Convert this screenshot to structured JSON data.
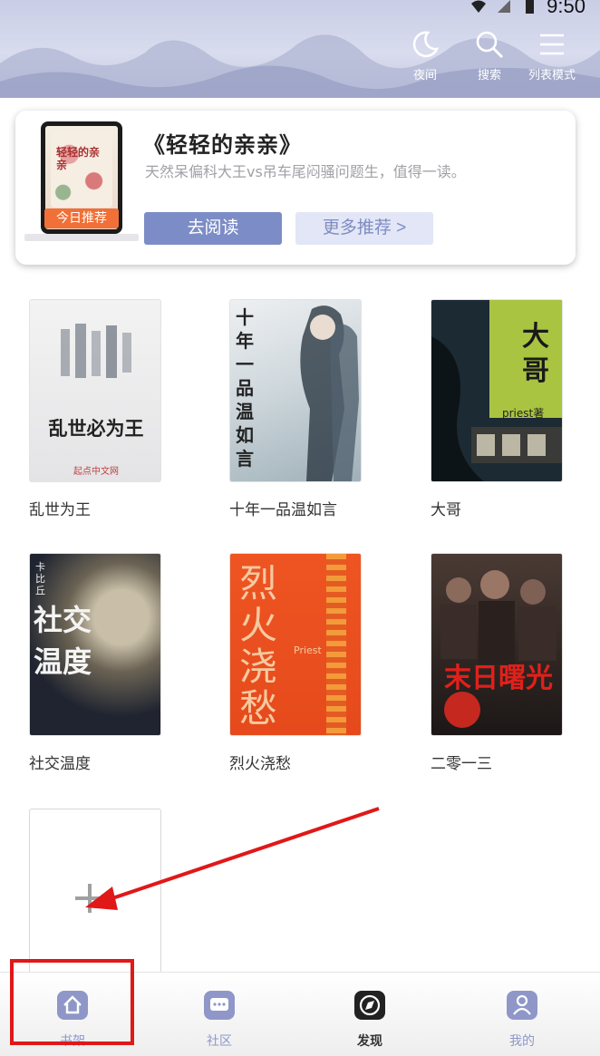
{
  "status_bar": {
    "time": "9:50"
  },
  "top_actions": [
    {
      "label": "夜间",
      "icon": "moon-icon"
    },
    {
      "label": "搜索",
      "icon": "search-icon"
    },
    {
      "label": "列表模式",
      "icon": "list-icon"
    }
  ],
  "recommend": {
    "badge": "今日推荐",
    "cover_text": "轻轻的亲亲",
    "title": "《轻轻的亲亲》",
    "description": "天然呆偏科大王vs吊车尾闷骚问题生，值得一读。",
    "read_button": "去阅读",
    "more_button": "更多推荐 >"
  },
  "books": [
    {
      "title": "乱世为王",
      "cover_text": "乱世必为王",
      "cover_sub": "起点中文网"
    },
    {
      "title": "十年一品温如言",
      "cover_text": "十年一品温如言"
    },
    {
      "title": "大哥",
      "cover_text": "大哥",
      "cover_sub": "priest著"
    },
    {
      "title": "社交温度",
      "cover_text": "社交温度",
      "cover_sub": "卡比丘"
    },
    {
      "title": "烈火浇愁",
      "cover_text": "烈火浇愁",
      "cover_sub": "Priest"
    },
    {
      "title": "二零一三",
      "cover_text": "末日曙光"
    }
  ],
  "bottom_nav": [
    {
      "label": "书架",
      "icon": "home-icon",
      "active": false
    },
    {
      "label": "社区",
      "icon": "chat-icon",
      "active": false
    },
    {
      "label": "发现",
      "icon": "compass-icon",
      "active": true
    },
    {
      "label": "我的",
      "icon": "user-icon",
      "active": false
    }
  ],
  "colors": {
    "accent": "#7c8cc6",
    "badge": "#f07038",
    "highlight": "#e01818"
  }
}
